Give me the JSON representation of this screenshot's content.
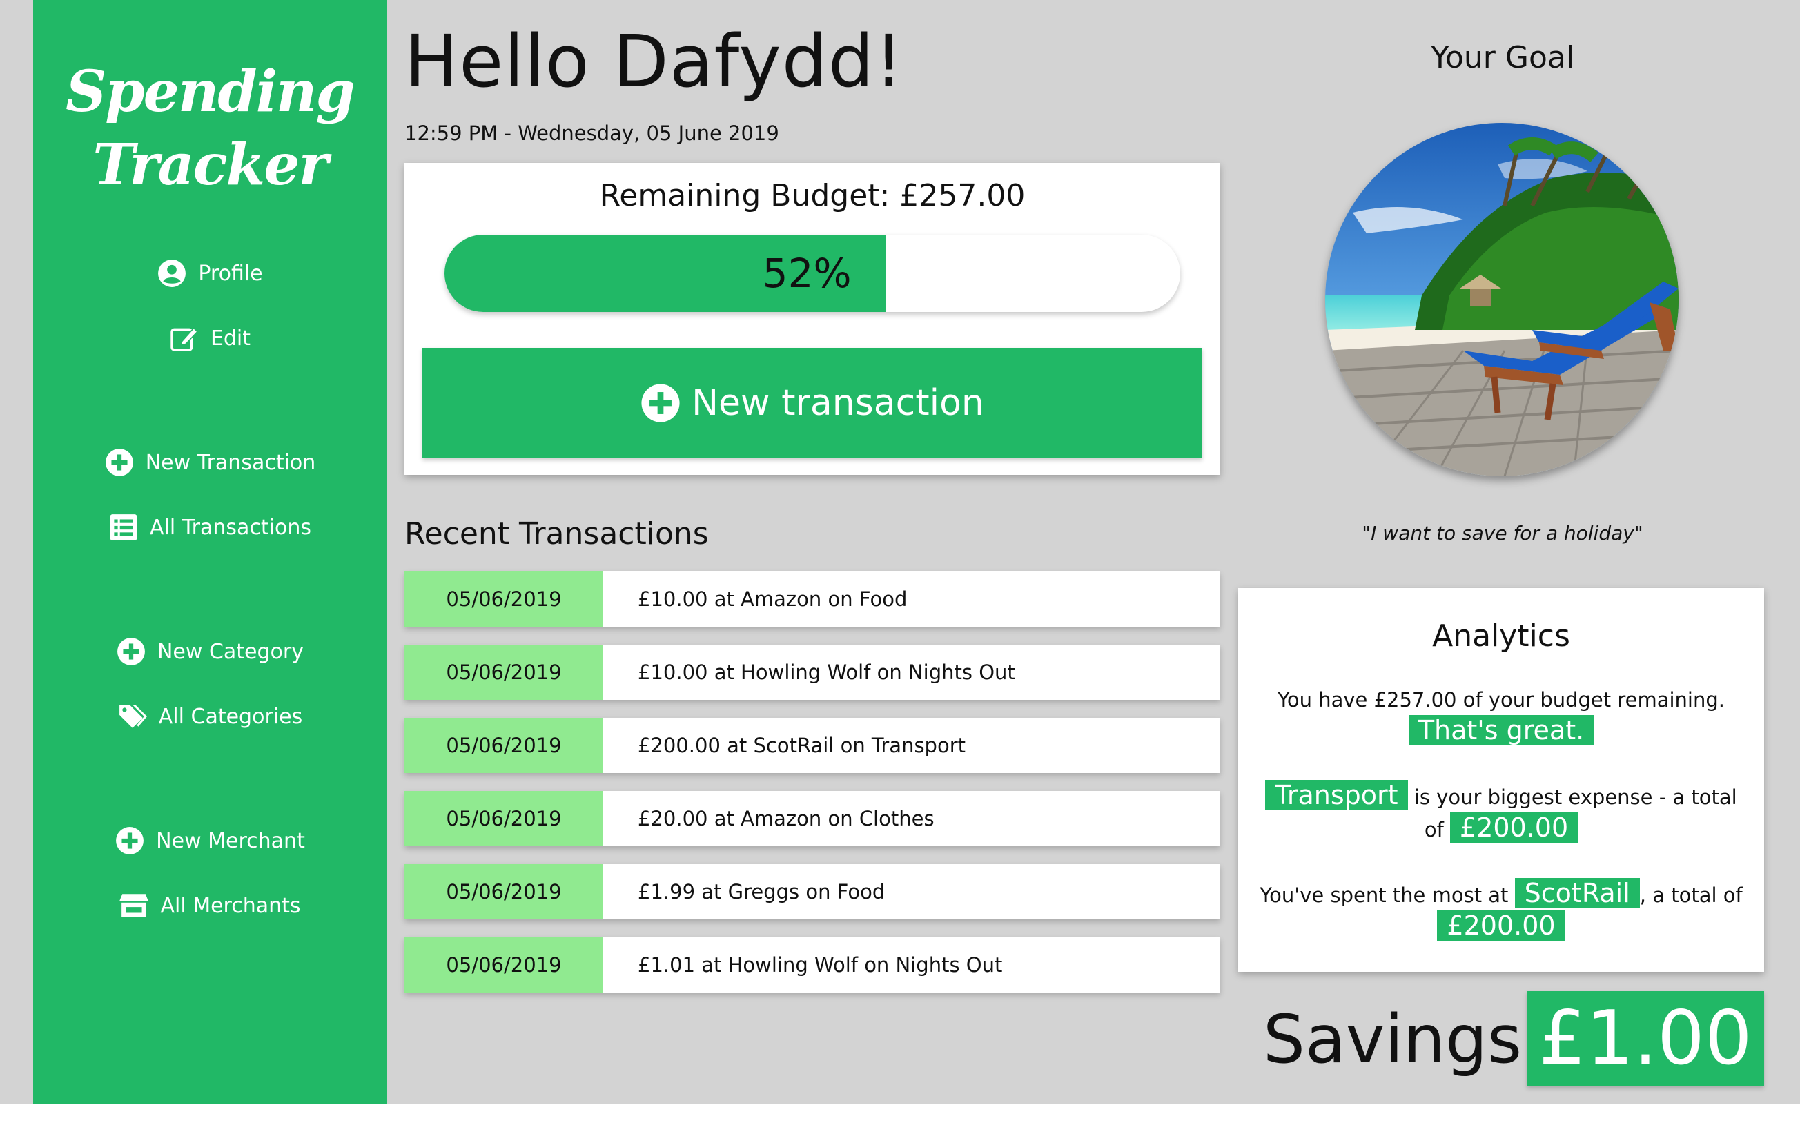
{
  "app": {
    "logo_line1": "Spending",
    "logo_line2": "Tracker"
  },
  "sidebar": {
    "items": [
      {
        "label": "Profile",
        "icon": "user-circle-icon"
      },
      {
        "label": "Edit",
        "icon": "edit-icon"
      },
      {
        "label": "New Transaction",
        "icon": "plus-circle-icon"
      },
      {
        "label": "All Transactions",
        "icon": "list-icon"
      },
      {
        "label": "New Category",
        "icon": "plus-circle-icon"
      },
      {
        "label": "All Categories",
        "icon": "tags-icon"
      },
      {
        "label": "New Merchant",
        "icon": "plus-circle-icon"
      },
      {
        "label": "All Merchants",
        "icon": "store-icon"
      }
    ]
  },
  "header": {
    "greeting": "Hello Dafydd!",
    "datetime": "12:59 PM - Wednesday, 05 June 2019"
  },
  "budget": {
    "title": "Remaining Budget: £257.00",
    "progress_percent": 60,
    "progress_label": "52%",
    "new_transaction_label": "New transaction"
  },
  "recent": {
    "title": "Recent Transactions",
    "transactions": [
      {
        "date": "05/06/2019",
        "description": "£10.00 at Amazon on Food"
      },
      {
        "date": "05/06/2019",
        "description": "£10.00 at Howling Wolf on Nights Out"
      },
      {
        "date": "05/06/2019",
        "description": "£200.00 at ScotRail on Transport"
      },
      {
        "date": "05/06/2019",
        "description": "£20.00 at Amazon on Clothes"
      },
      {
        "date": "05/06/2019",
        "description": "£1.99 at Greggs on Food"
      },
      {
        "date": "05/06/2019",
        "description": "£1.01 at Howling Wolf on Nights Out"
      }
    ]
  },
  "goal": {
    "title": "Your Goal",
    "quote": "\"I want to save for a holiday\""
  },
  "analytics": {
    "title": "Analytics",
    "remaining_text": "You have £257.00 of your budget remaining.",
    "remaining_highlight": "That's great.",
    "expense_highlight": "Transport",
    "expense_text_1": " is your biggest expense - a total of ",
    "expense_amount": "£200.00",
    "merchant_text_1": "You've spent the most at ",
    "merchant_highlight": "ScotRail",
    "merchant_text_2": ", a total of ",
    "merchant_amount": "£200.00"
  },
  "savings": {
    "label": "Savings:",
    "value": "£1.00"
  },
  "colors": {
    "brand_green": "#21b866",
    "date_green": "#90ea90",
    "background": "#d3d3d3"
  }
}
